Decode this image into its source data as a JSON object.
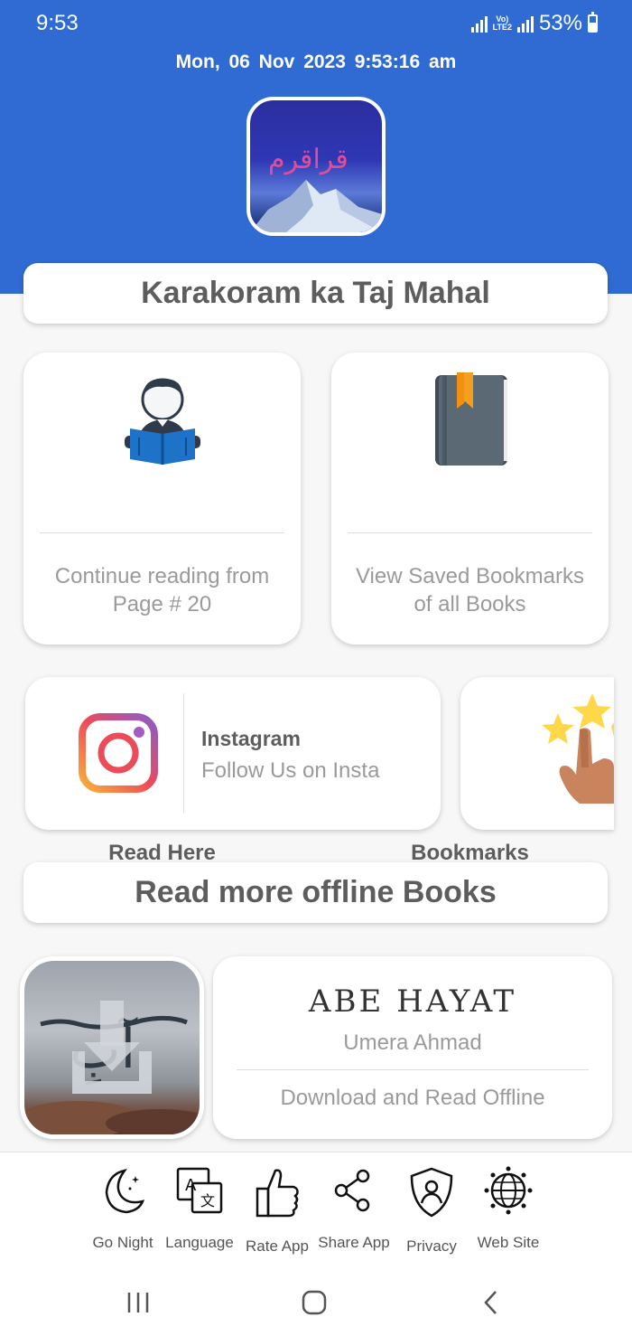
{
  "status_bar": {
    "time": "9:53",
    "network": "LTE2",
    "battery": "53%"
  },
  "header": {
    "datetime": "Mon, 06  Nov  2023   9:53:16 am"
  },
  "app_title": "Karakoram ka Taj Mahal",
  "features": [
    {
      "title": "Read Here",
      "desc_line1": "Continue reading from",
      "desc_line2": "Page # 20"
    },
    {
      "title": "Bookmarks",
      "desc_line1": "View Saved Bookmarks",
      "desc_line2": "of all Books"
    }
  ],
  "instagram": {
    "title": "Instagram",
    "subtitle": "Follow Us on Insta"
  },
  "section_title": "Read more offline Books",
  "book": {
    "logo_text": "ABE HAYAT",
    "author": "Umera Ahmad",
    "action": "Download and Read Offline"
  },
  "bottom_bar": [
    {
      "label": "Go Night",
      "icon": "moon-icon"
    },
    {
      "label": "Language",
      "icon": "translate-icon"
    },
    {
      "label": "Rate App",
      "icon": "thumbs-up-icon"
    },
    {
      "label": "Share App",
      "icon": "share-icon"
    },
    {
      "label": "Privacy",
      "icon": "shield-user-icon"
    },
    {
      "label": "Web Site",
      "icon": "globe-icon"
    }
  ],
  "colors": {
    "header_blue": "#2f6bd3",
    "card_bg": "#ffffff",
    "page_bg": "#f7f7f7"
  }
}
